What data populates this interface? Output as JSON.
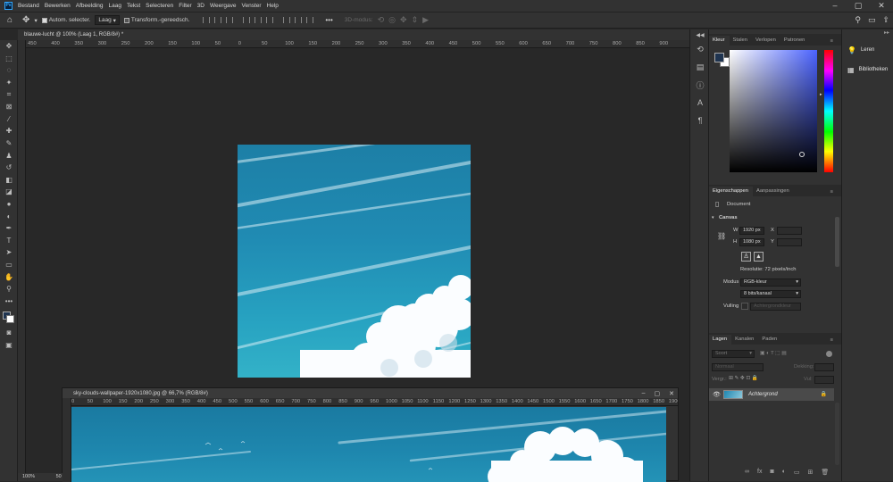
{
  "menu": {
    "logo": "Ps",
    "items": [
      "Bestand",
      "Bewerken",
      "Afbeelding",
      "Laag",
      "Tekst",
      "Selecteren",
      "Filter",
      "3D",
      "Weergave",
      "Venster",
      "Help"
    ]
  },
  "options": {
    "auto_select_label": "Autom. selecter.",
    "auto_select_target": "Laag",
    "transform_label": "Transform.-gereedsch.",
    "more": "•••",
    "mode_3d": "3D-modus:"
  },
  "document": {
    "tab_title": "blauwe-lucht @ 100% (Laag 1, RGB/8#) *",
    "ruler_ticks": [
      "450",
      "400",
      "350",
      "300",
      "250",
      "200",
      "150",
      "100",
      "50",
      "0",
      "50",
      "100",
      "150",
      "200",
      "250",
      "300",
      "350",
      "400",
      "450",
      "500",
      "550",
      "600",
      "650",
      "700",
      "750",
      "800",
      "850",
      "900"
    ]
  },
  "floating_window": {
    "title": "sky-clouds-wallpaper-1920x1080.jpg @ 66,7% (RGB/8#)",
    "ruler_ticks": [
      "0",
      "50",
      "100",
      "150",
      "200",
      "250",
      "300",
      "350",
      "400",
      "450",
      "500",
      "550",
      "600",
      "650",
      "700",
      "750",
      "800",
      "850",
      "900",
      "950",
      "1000",
      "1050",
      "1100",
      "1150",
      "1200",
      "1250",
      "1300",
      "1350",
      "1400",
      "1450",
      "1500",
      "1550",
      "1600",
      "1650",
      "1700",
      "1750",
      "1800",
      "1850",
      "1900"
    ]
  },
  "status": {
    "zoom_main": "100%",
    "zoom_float": "50"
  },
  "color_panel": {
    "tabs": [
      "Kleur",
      "Stalen",
      "Verlopen",
      "Patronen"
    ],
    "foreground": "#1f3450",
    "background": "#ffffff"
  },
  "properties_panel": {
    "tabs": [
      "Eigenschappen",
      "Aanpassingen"
    ],
    "doc_label": "Document",
    "section": "Canvas",
    "w_label": "W",
    "w_value": "1920 px",
    "h_label": "H",
    "h_value": "1080 px",
    "x_label": "X",
    "y_label": "Y",
    "resolution": "Resolutie: 72 pixels/inch",
    "mode_label": "Modus",
    "mode_value": "RGB-kleur",
    "bits_value": "8 bits/kanaal",
    "fill_label": "Vulling",
    "fill_value": "Achtergrondkleur"
  },
  "layers_panel": {
    "tabs": [
      "Lagen",
      "Kanalen",
      "Paden"
    ],
    "search_kind": "Soort",
    "blend_mode": "Normaal",
    "opacity_label": "Dekking:",
    "lock_label": "Vergr.:",
    "fill_label": "Vul:",
    "layer_name": "Achtergrond"
  },
  "learn_panel": {
    "items": [
      "Leren",
      "Bibliotheken"
    ]
  }
}
